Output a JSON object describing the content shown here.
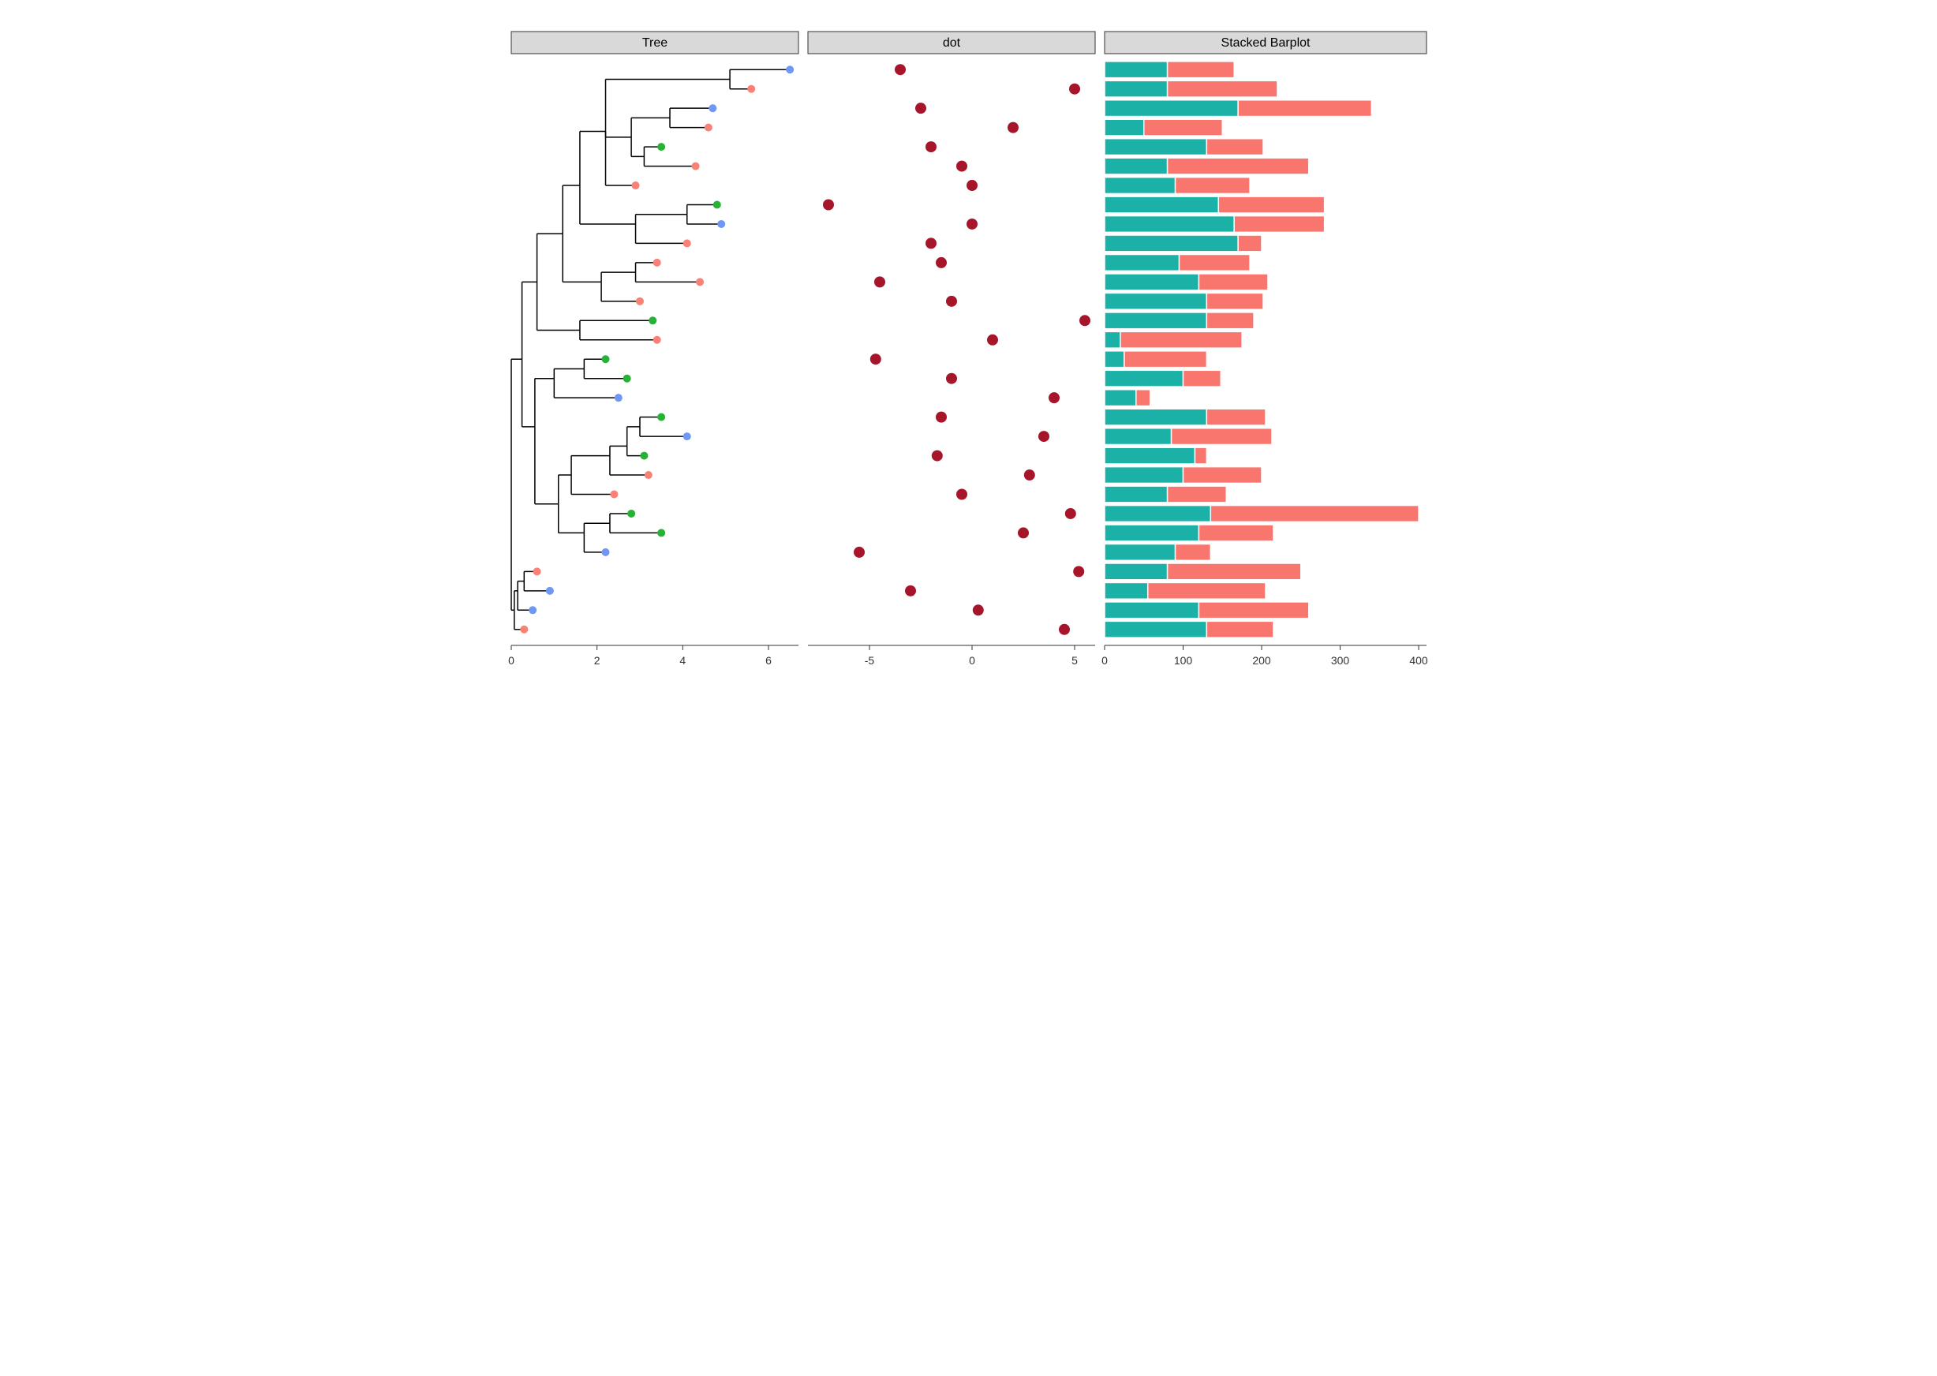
{
  "panels": {
    "tree": {
      "title": "Tree"
    },
    "dot": {
      "title": "dot"
    },
    "bar": {
      "title": "Stacked Barplot"
    }
  },
  "colors": {
    "tip_red": "#f98176",
    "tip_green": "#27b235",
    "tip_blue": "#6e97f6",
    "dot": "#a7152a",
    "bar_teal": "#1bb1a6",
    "bar_red": "#f8766d",
    "strip_bg": "#d9d9d9"
  },
  "chart_data": [
    {
      "type": "tree",
      "title": "Tree",
      "xlabel": "",
      "ylabel": "",
      "xlim": [
        0,
        6.7
      ],
      "xticks": [
        0,
        2,
        4,
        6
      ],
      "n_tips": 30,
      "tips": [
        {
          "x": 6.5,
          "color": "tip_blue"
        },
        {
          "x": 5.6,
          "color": "tip_red"
        },
        {
          "x": 4.7,
          "color": "tip_blue"
        },
        {
          "x": 4.6,
          "color": "tip_red"
        },
        {
          "x": 3.5,
          "color": "tip_green"
        },
        {
          "x": 4.3,
          "color": "tip_red"
        },
        {
          "x": 2.9,
          "color": "tip_red"
        },
        {
          "x": 4.8,
          "color": "tip_green"
        },
        {
          "x": 4.9,
          "color": "tip_blue"
        },
        {
          "x": 4.1,
          "color": "tip_red"
        },
        {
          "x": 3.4,
          "color": "tip_red"
        },
        {
          "x": 4.4,
          "color": "tip_red"
        },
        {
          "x": 3.0,
          "color": "tip_red"
        },
        {
          "x": 3.3,
          "color": "tip_green"
        },
        {
          "x": 3.4,
          "color": "tip_red"
        },
        {
          "x": 2.2,
          "color": "tip_green"
        },
        {
          "x": 2.7,
          "color": "tip_green"
        },
        {
          "x": 2.5,
          "color": "tip_blue"
        },
        {
          "x": 3.5,
          "color": "tip_green"
        },
        {
          "x": 4.1,
          "color": "tip_blue"
        },
        {
          "x": 3.1,
          "color": "tip_green"
        },
        {
          "x": 3.2,
          "color": "tip_red"
        },
        {
          "x": 2.4,
          "color": "tip_red"
        },
        {
          "x": 2.8,
          "color": "tip_green"
        },
        {
          "x": 3.5,
          "color": "tip_green"
        },
        {
          "x": 2.2,
          "color": "tip_blue"
        },
        {
          "x": 0.6,
          "color": "tip_red"
        },
        {
          "x": 0.9,
          "color": "tip_blue"
        },
        {
          "x": 0.5,
          "color": "tip_blue"
        },
        {
          "x": 0.3,
          "color": "tip_red"
        }
      ],
      "edges": [
        {
          "parent": 57,
          "child": 58,
          "px": 0.0,
          "cx": 0.07
        },
        {
          "parent": 58,
          "child": 56,
          "px": 0.07,
          "cx": 0.15
        },
        {
          "parent": 58,
          "child": 30,
          "px": 0.07,
          "cx": 0.3
        },
        {
          "parent": 56,
          "child": 29,
          "px": 0.15,
          "cx": 0.5
        },
        {
          "parent": 56,
          "child": 55,
          "px": 0.15,
          "cx": 0.3
        },
        {
          "parent": 55,
          "child": 28,
          "px": 0.3,
          "cx": 0.9
        },
        {
          "parent": 55,
          "child": 27,
          "px": 0.3,
          "cx": 0.6
        },
        {
          "parent": 57,
          "child": 54,
          "px": 0.0,
          "cx": 0.25
        },
        {
          "parent": 54,
          "child": 53,
          "px": 0.25,
          "cx": 0.55
        },
        {
          "parent": 54,
          "child": 42,
          "px": 0.25,
          "cx": 0.6
        },
        {
          "parent": 53,
          "child": 52,
          "px": 0.55,
          "cx": 1.1
        },
        {
          "parent": 52,
          "child": 47,
          "px": 1.1,
          "cx": 1.4
        },
        {
          "parent": 52,
          "child": 51,
          "px": 1.1,
          "cx": 1.7
        },
        {
          "parent": 51,
          "child": 26,
          "px": 1.7,
          "cx": 2.2
        },
        {
          "parent": 51,
          "child": 50,
          "px": 1.7,
          "cx": 2.3
        },
        {
          "parent": 50,
          "child": 25,
          "px": 2.3,
          "cx": 3.5
        },
        {
          "parent": 50,
          "child": 24,
          "px": 2.3,
          "cx": 2.8
        },
        {
          "parent": 47,
          "child": 23,
          "px": 1.4,
          "cx": 2.4
        },
        {
          "parent": 47,
          "child": 48,
          "px": 1.4,
          "cx": 2.3
        },
        {
          "parent": 48,
          "child": 22,
          "px": 2.3,
          "cx": 3.2
        },
        {
          "parent": 48,
          "child": 49,
          "px": 2.3,
          "cx": 2.7
        },
        {
          "parent": 49,
          "child": 21,
          "px": 2.7,
          "cx": 3.1
        },
        {
          "parent": 49,
          "child": 46,
          "px": 2.7,
          "cx": 3.0
        },
        {
          "parent": 46,
          "child": 20,
          "px": 3.0,
          "cx": 4.1
        },
        {
          "parent": 46,
          "child": 19,
          "px": 3.0,
          "cx": 3.5
        },
        {
          "parent": 53,
          "child": 45,
          "px": 0.55,
          "cx": 1.0
        },
        {
          "parent": 45,
          "child": 18,
          "px": 1.0,
          "cx": 2.5
        },
        {
          "parent": 45,
          "child": 44,
          "px": 1.0,
          "cx": 1.7
        },
        {
          "parent": 44,
          "child": 17,
          "px": 1.7,
          "cx": 2.7
        },
        {
          "parent": 44,
          "child": 16,
          "px": 1.7,
          "cx": 2.2
        },
        {
          "parent": 42,
          "child": 43,
          "px": 0.6,
          "cx": 1.6
        },
        {
          "parent": 43,
          "child": 15,
          "px": 1.6,
          "cx": 3.4
        },
        {
          "parent": 43,
          "child": 14,
          "px": 1.6,
          "cx": 3.3
        },
        {
          "parent": 42,
          "child": 41,
          "px": 0.6,
          "cx": 1.2
        },
        {
          "parent": 41,
          "child": 40,
          "px": 1.2,
          "cx": 2.1
        },
        {
          "parent": 40,
          "child": 13,
          "px": 2.1,
          "cx": 3.0
        },
        {
          "parent": 40,
          "child": 39,
          "px": 2.1,
          "cx": 2.9
        },
        {
          "parent": 39,
          "child": 12,
          "px": 2.9,
          "cx": 4.4
        },
        {
          "parent": 39,
          "child": 11,
          "px": 2.9,
          "cx": 3.4
        },
        {
          "parent": 41,
          "child": 38,
          "px": 1.2,
          "cx": 1.6
        },
        {
          "parent": 38,
          "child": 36,
          "px": 1.6,
          "cx": 2.9
        },
        {
          "parent": 36,
          "child": 10,
          "px": 2.9,
          "cx": 4.1
        },
        {
          "parent": 36,
          "child": 37,
          "px": 2.9,
          "cx": 4.1
        },
        {
          "parent": 37,
          "child": 9,
          "px": 4.1,
          "cx": 4.9
        },
        {
          "parent": 37,
          "child": 8,
          "px": 4.1,
          "cx": 4.8
        },
        {
          "parent": 38,
          "child": 35,
          "px": 1.6,
          "cx": 2.2
        },
        {
          "parent": 35,
          "child": 7,
          "px": 2.2,
          "cx": 2.9
        },
        {
          "parent": 35,
          "child": 34,
          "px": 2.2,
          "cx": 2.8
        },
        {
          "parent": 34,
          "child": 33,
          "px": 2.8,
          "cx": 3.1
        },
        {
          "parent": 33,
          "child": 6,
          "px": 3.1,
          "cx": 4.3
        },
        {
          "parent": 33,
          "child": 5,
          "px": 3.1,
          "cx": 3.5
        },
        {
          "parent": 34,
          "child": 32,
          "px": 2.8,
          "cx": 3.7
        },
        {
          "parent": 32,
          "child": 4,
          "px": 3.7,
          "cx": 4.6
        },
        {
          "parent": 32,
          "child": 3,
          "px": 3.7,
          "cx": 4.7
        },
        {
          "parent": 35,
          "child": 31,
          "px": 2.2,
          "cx": 5.1
        },
        {
          "parent": 31,
          "child": 2,
          "px": 5.1,
          "cx": 5.6
        },
        {
          "parent": 31,
          "child": 1,
          "px": 5.1,
          "cx": 6.5
        }
      ],
      "internal_y": {
        "31": 1.5,
        "32": 3.5,
        "33": 5.5,
        "34": 4.5,
        "35": 4.2,
        "36": 9.0,
        "37": 8.5,
        "38": 7.0,
        "39": 11.5,
        "40": 12.0,
        "41": 9.5,
        "42": 12.0,
        "43": 14.5,
        "44": 16.5,
        "45": 17.0,
        "46": 19.5,
        "47": 22.0,
        "48": 21.0,
        "49": 20.5,
        "50": 24.5,
        "51": 25.0,
        "52": 23.5,
        "53": 19.5,
        "54": 16.0,
        "55": 27.5,
        "56": 28.0,
        "57": 22.0,
        "58": 29.0
      }
    },
    {
      "type": "scatter",
      "title": "dot",
      "xlabel": "",
      "ylabel": "",
      "xlim": [
        -8,
        6
      ],
      "xticks": [
        -5,
        0,
        5
      ],
      "x": [
        -3.5,
        5.0,
        -2.5,
        2.0,
        -2.0,
        -0.5,
        0.0,
        -7.0,
        0.0,
        -2.0,
        -1.5,
        -4.5,
        -1.0,
        5.5,
        1.0,
        -4.7,
        -1.0,
        4.0,
        -1.5,
        3.5,
        -1.7,
        2.8,
        -0.5,
        4.8,
        2.5,
        -5.5,
        5.2,
        -3.0,
        0.3,
        4.5
      ]
    },
    {
      "type": "bar",
      "title": "Stacked Barplot",
      "xlabel": "",
      "ylabel": "",
      "xlim": [
        0,
        410
      ],
      "xticks": [
        0,
        100,
        200,
        300,
        400
      ],
      "stack_order": [
        "teal",
        "red"
      ],
      "series": [
        {
          "name": "teal",
          "values": [
            80,
            80,
            170,
            50,
            130,
            80,
            90,
            145,
            165,
            170,
            95,
            120,
            130,
            130,
            20,
            25,
            100,
            40,
            130,
            85,
            115,
            100,
            80,
            135,
            120,
            90,
            80,
            55,
            120,
            130
          ]
        },
        {
          "name": "red",
          "values": [
            85,
            140,
            170,
            100,
            72,
            180,
            95,
            135,
            115,
            30,
            90,
            88,
            72,
            60,
            155,
            105,
            48,
            18,
            75,
            128,
            15,
            100,
            75,
            265,
            95,
            45,
            170,
            150,
            140,
            85
          ]
        }
      ]
    }
  ]
}
